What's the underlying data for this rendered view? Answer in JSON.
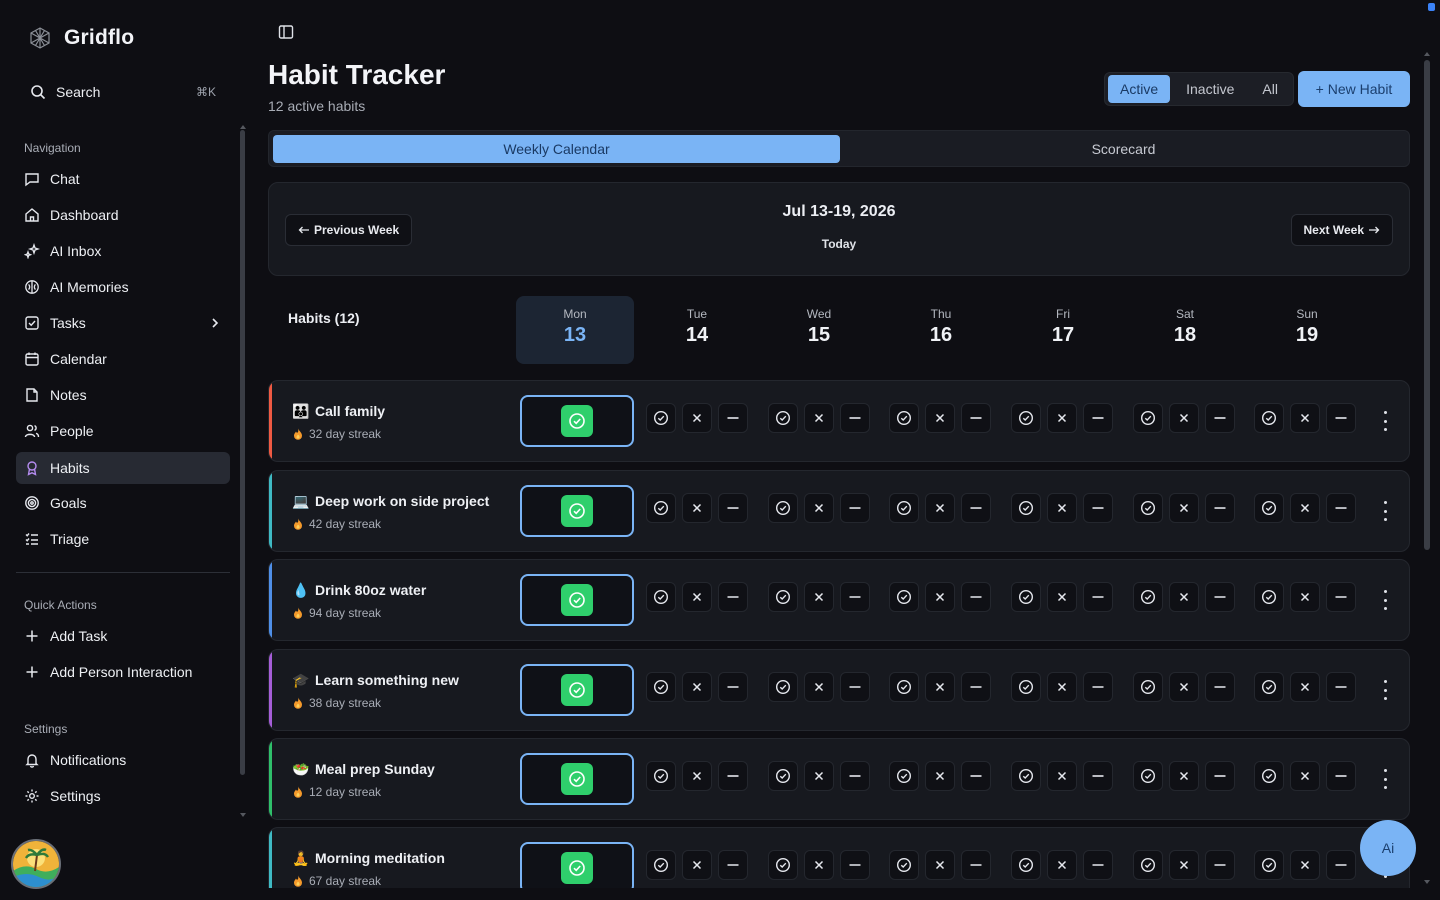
{
  "app": {
    "name": "Gridflo"
  },
  "search": {
    "label": "Search",
    "shortcut": "⌘K"
  },
  "nav": {
    "section": "Navigation",
    "items": [
      {
        "label": "Chat",
        "icon": "chat-icon"
      },
      {
        "label": "Dashboard",
        "icon": "home-icon"
      },
      {
        "label": "AI Inbox",
        "icon": "sparkles-icon"
      },
      {
        "label": "AI Memories",
        "icon": "brain-icon"
      },
      {
        "label": "Tasks",
        "icon": "checkbox-icon"
      },
      {
        "label": "Calendar",
        "icon": "calendar-icon"
      },
      {
        "label": "Notes",
        "icon": "note-icon"
      },
      {
        "label": "People",
        "icon": "people-icon"
      },
      {
        "label": "Habits",
        "icon": "award-icon",
        "active": true
      },
      {
        "label": "Goals",
        "icon": "target-icon"
      },
      {
        "label": "Triage",
        "icon": "list-icon"
      }
    ]
  },
  "quick_actions": {
    "section": "Quick Actions",
    "items": [
      {
        "label": "Add Task"
      },
      {
        "label": "Add Person Interaction"
      }
    ]
  },
  "settings": {
    "section": "Settings",
    "items": [
      {
        "label": "Notifications",
        "icon": "bell-icon"
      },
      {
        "label": "Settings",
        "icon": "gear-icon"
      }
    ]
  },
  "page": {
    "title": "Habit Tracker",
    "subtitle": "12 active habits"
  },
  "filters": {
    "options": [
      "Active",
      "Inactive",
      "All"
    ],
    "selected": "Active"
  },
  "new_habit_label": "+ New Habit",
  "view_tabs": {
    "options": [
      "Weekly Calendar",
      "Scorecard"
    ],
    "selected": "Weekly Calendar"
  },
  "week": {
    "range": "Jul 13-19, 2026",
    "today_label": "Today",
    "prev_label": "Previous Week",
    "next_label": "Next Week"
  },
  "habits_header": "Habits (12)",
  "days": [
    {
      "name": "Mon",
      "num": "13",
      "today": true
    },
    {
      "name": "Tue",
      "num": "14"
    },
    {
      "name": "Wed",
      "num": "15"
    },
    {
      "name": "Thu",
      "num": "16"
    },
    {
      "name": "Fri",
      "num": "17"
    },
    {
      "name": "Sat",
      "num": "18"
    },
    {
      "name": "Sun",
      "num": "19"
    }
  ],
  "habits": [
    {
      "name": "Call family",
      "emoji": "👪",
      "streak": "32 day streak",
      "accent": "#ef5a43"
    },
    {
      "name": "Deep work on side project",
      "emoji": "💻",
      "streak": "42 day streak",
      "accent": "#3fbac4"
    },
    {
      "name": "Drink 80oz water",
      "emoji": "💧",
      "streak": "94 day streak",
      "accent": "#4f8fe8"
    },
    {
      "name": "Learn something new",
      "emoji": "🎓",
      "streak": "38 day streak",
      "accent": "#a65ed8"
    },
    {
      "name": "Meal prep Sunday",
      "emoji": "🥗",
      "streak": "12 day streak",
      "accent": "#2fbf6a"
    },
    {
      "name": "Morning meditation",
      "emoji": "🧘",
      "streak": "67 day streak",
      "accent": "#3fbac4"
    }
  ],
  "ai_button_label": "Ai",
  "colors": {
    "accent": "#7ab4f5",
    "success": "#2fcf6c",
    "background": "#0e0e13",
    "card": "#17191f"
  }
}
